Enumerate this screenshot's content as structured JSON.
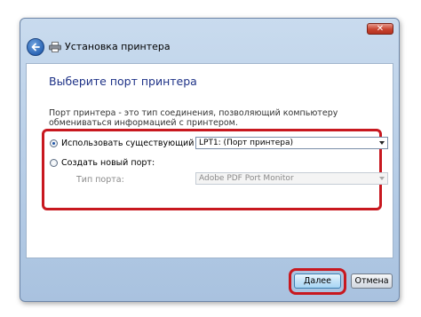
{
  "window": {
    "title": "Установка принтера",
    "close_glyph": "✕"
  },
  "page": {
    "heading": "Выберите порт принтера",
    "description": "Порт принтера - это тип соединения, позволяющий компьютеру обмениваться информацией с принтером."
  },
  "options": {
    "existing_port": {
      "label": "Использовать существующий порт:",
      "checked": true,
      "selected_value": "LPT1: (Порт принтера)"
    },
    "new_port": {
      "label": "Создать новый порт:",
      "checked": false,
      "type_label": "Тип порта:",
      "selected_value": "Adobe PDF Port Monitor"
    }
  },
  "buttons": {
    "next_label": "Далее",
    "cancel_label": "Отмена"
  },
  "colors": {
    "highlight": "#c8181f",
    "heading": "#1e3287"
  },
  "icons": {
    "back": "back-arrow-icon",
    "printer": "printer-icon",
    "close": "close-icon",
    "dropdown": "chevron-down-icon"
  }
}
